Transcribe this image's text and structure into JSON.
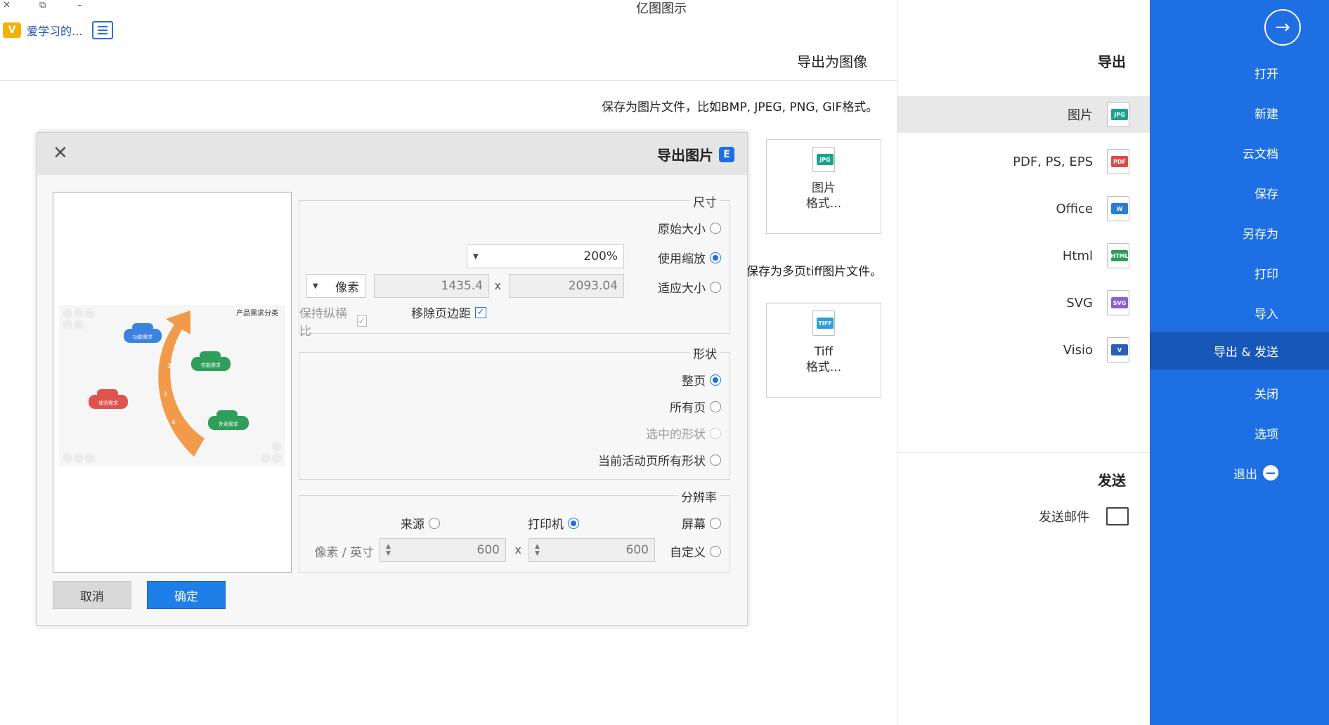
{
  "window": {
    "title": "亿图图示",
    "close_icon": "✕",
    "restore_icon": "⧉",
    "minimize_icon": "–"
  },
  "user": {
    "name": "爱学习的...",
    "vip_icon": "V"
  },
  "sidebar": {
    "back_icon": "→",
    "items": [
      {
        "label": "打开"
      },
      {
        "label": "新建"
      },
      {
        "label": "云文档"
      },
      {
        "label": "保存"
      },
      {
        "label": "另存为"
      },
      {
        "label": "打印"
      },
      {
        "label": "导入"
      },
      {
        "label": "导出 & 发送"
      },
      {
        "label": "关闭"
      },
      {
        "label": "选项"
      },
      {
        "label": "退出"
      }
    ],
    "active_index": 7,
    "exit_icon": "−"
  },
  "export_panel": {
    "heading": "导出",
    "items": [
      {
        "label": "图片",
        "icon_tag": "JPG",
        "icon_color": "#1aa38a"
      },
      {
        "label": "PDF, PS, EPS",
        "icon_tag": "PDF",
        "icon_color": "#e04848"
      },
      {
        "label": "Office",
        "icon_tag": "W",
        "icon_color": "#2b7cd3"
      },
      {
        "label": "Html",
        "icon_tag": "HTML",
        "icon_color": "#2e9a5a"
      },
      {
        "label": "SVG",
        "icon_tag": "SVG",
        "icon_color": "#8a5fd0"
      },
      {
        "label": "Visio",
        "icon_tag": "V",
        "icon_color": "#2b5fb8"
      }
    ],
    "active_index": 0,
    "send_heading": "发送",
    "send_item": "发送邮件"
  },
  "main": {
    "title": "导出为图像",
    "desc_image": "保存为图片文件，比如BMP, JPEG, PNG, GIF格式。",
    "desc_tiff": "保存为多页tiff图片文件。",
    "card_image": {
      "line1": "图片",
      "line2": "格式...",
      "tag": "JPG"
    },
    "card_tiff": {
      "line1": "Tiff",
      "line2": "格式...",
      "tag": "TIFF"
    }
  },
  "dialog": {
    "title": "导出图片",
    "logo": "E",
    "close_icon": "✕",
    "size": {
      "title": "尺寸",
      "original": "原始大小",
      "use_zoom": "使用缩放",
      "zoom_value": "200%",
      "fit": "适应大小",
      "width": "2093.04",
      "height": "1435.4",
      "unit": "像素",
      "remove_margin": "移除页边距",
      "keep_ratio": "保持纵横比",
      "x": "x"
    },
    "shape": {
      "title": "形状",
      "whole_page": "整页",
      "all_pages": "所有页",
      "selected": "选中的形状",
      "current_page_all": "当前活动页所有形状"
    },
    "resolution": {
      "title": "分辨率",
      "screen": "屏幕",
      "printer": "打印机",
      "source": "来源",
      "custom": "自定义",
      "dpi_x": "600",
      "dpi_y": "600",
      "unit": "像素 / 英寸",
      "x": "x"
    },
    "preview": {
      "title": "产品需求分类",
      "labels": [
        "功能需求",
        "性能需求",
        "外观需求",
        "体验需求"
      ],
      "steps": [
        "1",
        "2",
        "3",
        "4"
      ]
    },
    "ok": "确定",
    "cancel": "取消"
  }
}
